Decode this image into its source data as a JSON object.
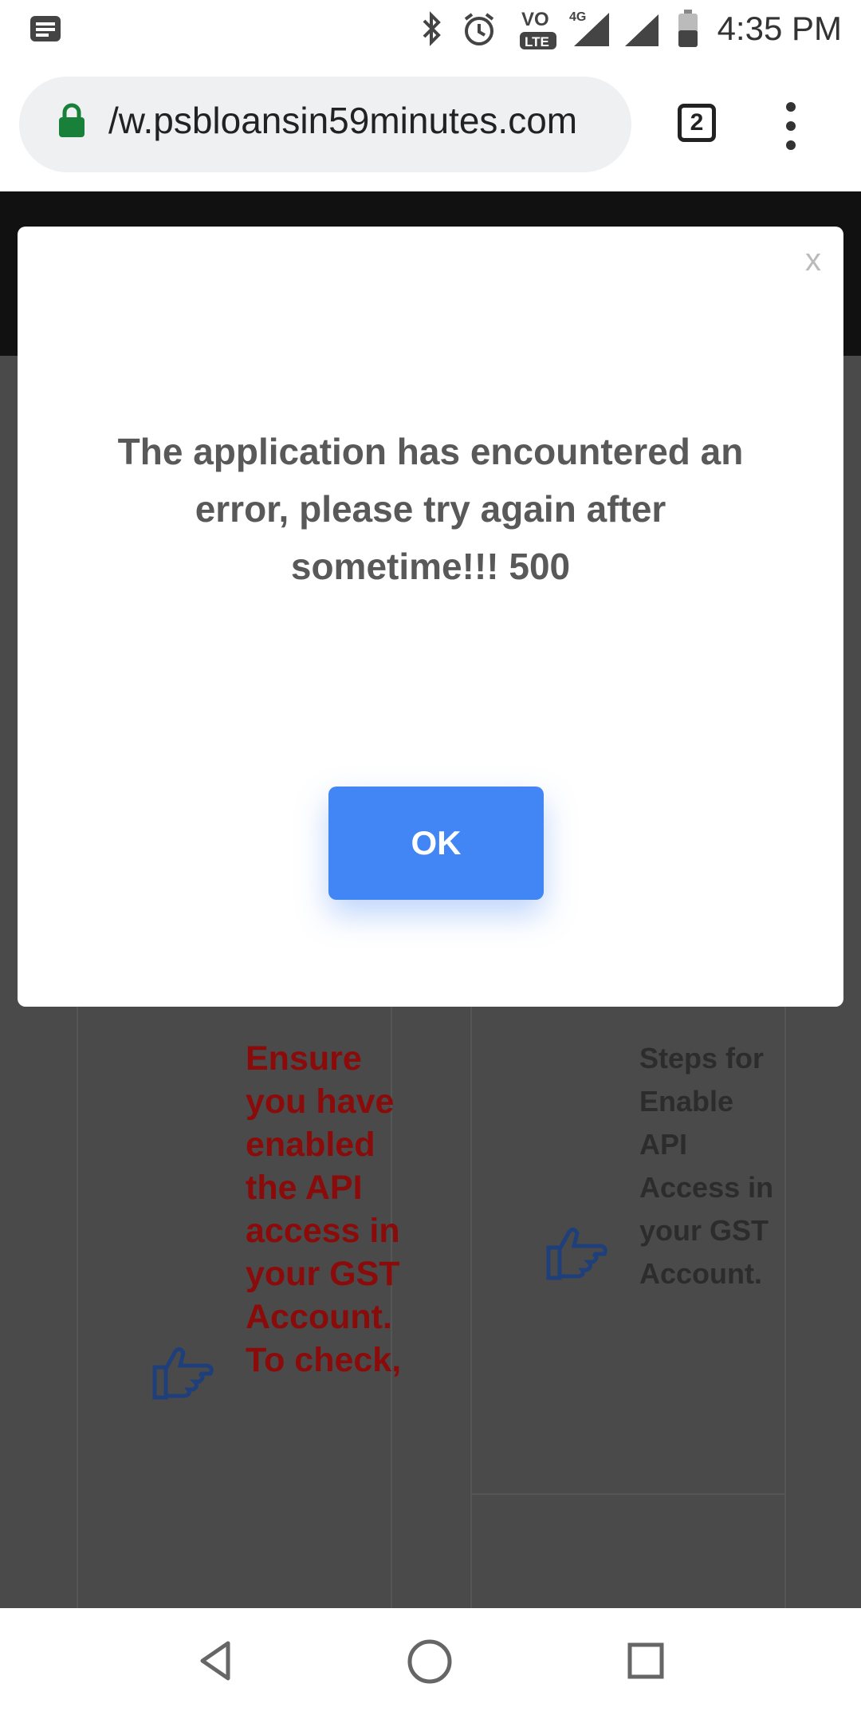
{
  "status_bar": {
    "time": "4:35 PM",
    "network": "4G",
    "volte": "LTE"
  },
  "browser": {
    "url": "/w.psbloansin59minutes.com",
    "tab_count": "2"
  },
  "dialog": {
    "close_label": "x",
    "message": "The application has encountered an error, please try again after sometime!!! 500",
    "ok_label": "OK"
  },
  "background": {
    "left_card_text": "Ensure you have enabled the API access in your GST Account. To check,",
    "right_card_text": "Steps for Enable API Access in your GST Account."
  },
  "colors": {
    "primary_button": "#4285f4",
    "warning_text": "#8b0a0a",
    "lock_icon": "#188038"
  }
}
